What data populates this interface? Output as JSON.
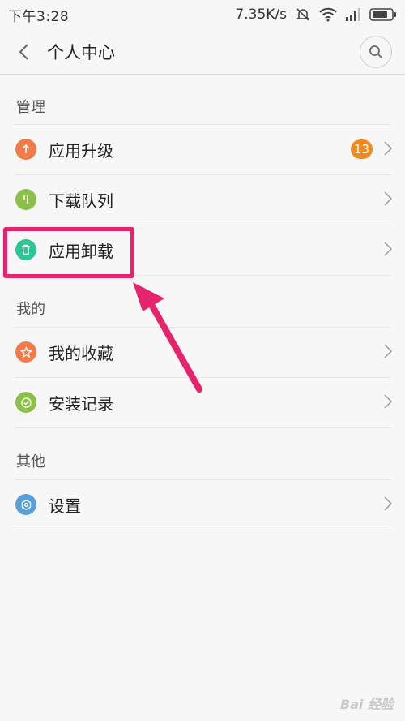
{
  "status_bar": {
    "time": "下午3:28",
    "speed": "7.35K/s"
  },
  "header": {
    "title": "个人中心"
  },
  "sections": [
    {
      "header": "管理",
      "items": [
        {
          "label": "应用升级",
          "badge": "13",
          "icon": "arrow-up-icon",
          "color": "#f07c4a"
        },
        {
          "label": "下载队列",
          "icon": "download-icon",
          "color": "#8dc04a"
        },
        {
          "label": "应用卸载",
          "icon": "trash-icon",
          "color": "#2ec596"
        }
      ]
    },
    {
      "header": "我的",
      "items": [
        {
          "label": "我的收藏",
          "icon": "star-icon",
          "color": "#f07c4a"
        },
        {
          "label": "安装记录",
          "icon": "check-icon",
          "color": "#8dc04a"
        }
      ]
    },
    {
      "header": "其他",
      "items": [
        {
          "label": "设置",
          "icon": "gear-icon",
          "color": "#5a9fd6"
        }
      ]
    }
  ],
  "colors": {
    "highlight": "#e6246e",
    "badge": "#f08a1c"
  },
  "watermark": "Bai 经验"
}
